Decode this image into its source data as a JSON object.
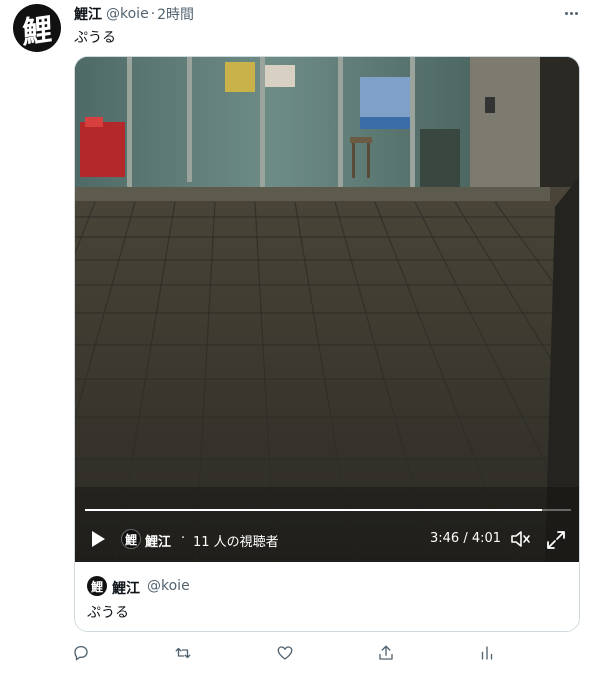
{
  "tweet": {
    "avatar_glyph": "鯉",
    "display_name": "鯉江",
    "handle": "@koie",
    "separator": "·",
    "time": "2時間",
    "text": "ぷうる",
    "more_icon": "more-horizontal-icon"
  },
  "video": {
    "progress": 0.94,
    "channel_name": "鯉江",
    "channel_separator": "·",
    "viewers": "11 人の視聴者",
    "timecode": "3:46 / 4:01",
    "icons": [
      "play-icon",
      "volume-icon",
      "fullscreen-icon"
    ]
  },
  "quote": {
    "display_name": "鯉江",
    "handle": "@koie",
    "text": "ぷうる"
  },
  "actions": [
    "reply-icon",
    "retweet-icon",
    "like-icon",
    "share-icon",
    "analytics-icon"
  ],
  "colors": {
    "text": "#0f1419",
    "secondary": "#536471",
    "border": "#cfd9de"
  }
}
